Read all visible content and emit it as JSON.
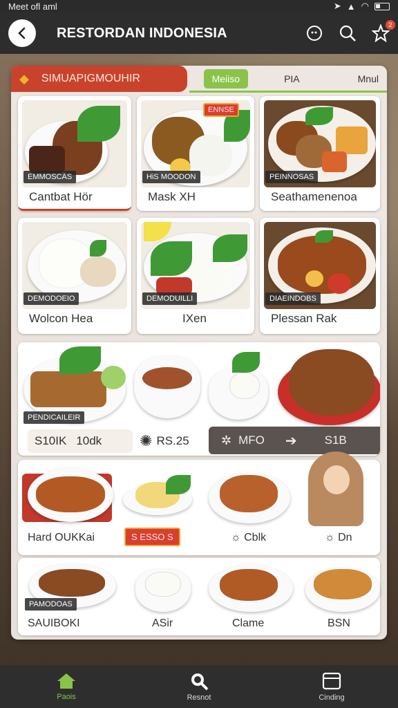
{
  "status": {
    "carrier": "Meet ofl aml"
  },
  "appbar": {
    "title": "RESTORDAN INDONESIA",
    "notification_count": "2"
  },
  "category": {
    "label": "SIMUAPIGMOUHIR"
  },
  "tabs": [
    {
      "label": "Meiiso",
      "active": true
    },
    {
      "label": "PIA",
      "active": false
    },
    {
      "label": "Mnul",
      "active": false
    }
  ],
  "menu_grid": [
    {
      "tag": "EMMOSCAS",
      "name": "Cantbat Hör"
    },
    {
      "tag": "HiS MOODON",
      "name": "Mask     XH",
      "badge": "ENNSE"
    },
    {
      "tag": "PEINNOSAS",
      "name": "Seathamenenoa"
    },
    {
      "tag": "DEMODOEIO",
      "name": "Wolcon Hea"
    },
    {
      "tag": "DEMODUILLI",
      "name": "IXen"
    },
    {
      "tag": "DIAEINDOBS",
      "name": "Plessan Rak"
    }
  ],
  "feature": {
    "tag": "PENDICAILEIR",
    "price_a": "S10IK",
    "price_b": "10dk",
    "promo": "RS.25",
    "info_label": "MFO",
    "info_value": "S1B"
  },
  "row3": [
    {
      "name": "Hard OUKKai"
    },
    {
      "name": "S ESSO S",
      "highlight": true
    },
    {
      "name": "Cblk"
    },
    {
      "name": "Dn"
    }
  ],
  "row4": {
    "tag": "PAMODOAS",
    "items": [
      {
        "name": "SAUIBOKI"
      },
      {
        "name": "ASir"
      },
      {
        "name": "Clame"
      },
      {
        "name": "BSN"
      }
    ]
  },
  "bottom_nav": [
    {
      "label": "Paois",
      "icon": "home-icon",
      "active": true
    },
    {
      "label": "Resnot",
      "icon": "search-icon",
      "active": false
    },
    {
      "label": "Cinding",
      "icon": "clipboard-icon",
      "active": false
    }
  ],
  "colors": {
    "accent": "#8bc34a",
    "category_red": "#c9432c",
    "appbar": "#2d2d2d"
  }
}
